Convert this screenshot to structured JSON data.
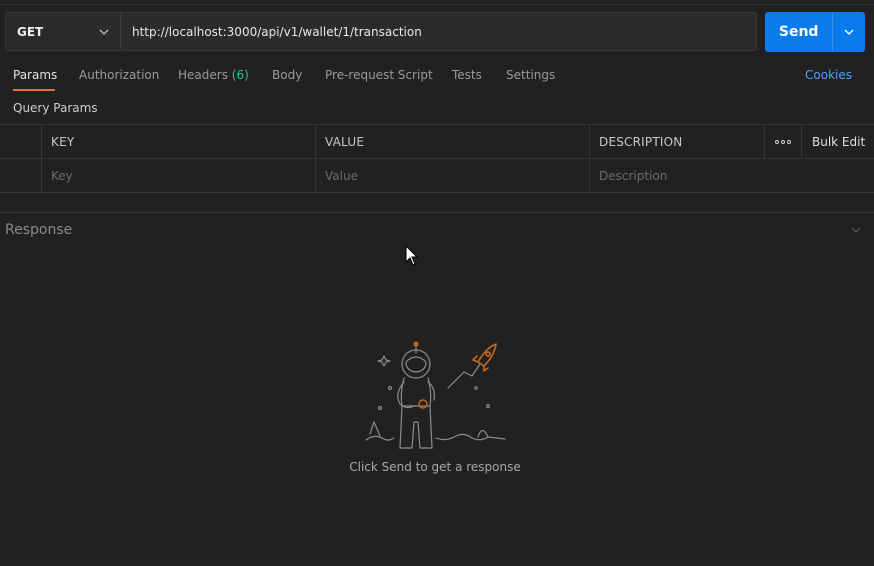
{
  "request": {
    "method": "GET",
    "url": "http://localhost:3000/api/v1/wallet/1/transaction",
    "send_label": "Send"
  },
  "tabs": [
    {
      "label": "Params"
    },
    {
      "label": "Authorization"
    },
    {
      "label": "Headers",
      "count": "(6)"
    },
    {
      "label": "Body"
    },
    {
      "label": "Pre-request Script"
    },
    {
      "label": "Tests"
    },
    {
      "label": "Settings"
    }
  ],
  "cookies_label": "Cookies",
  "query_params": {
    "title": "Query Params",
    "columns": {
      "key": "KEY",
      "value": "VALUE",
      "description": "DESCRIPTION"
    },
    "bulk_edit": "Bulk Edit",
    "placeholders": {
      "key": "Key",
      "value": "Value",
      "description": "Description"
    }
  },
  "response": {
    "title": "Response",
    "empty_message": "Click Send to get a response"
  },
  "colors": {
    "accent": "#097bed",
    "active_tab": "#f26b3a",
    "header_count": "#2bc48a",
    "link": "#4da3ff"
  }
}
